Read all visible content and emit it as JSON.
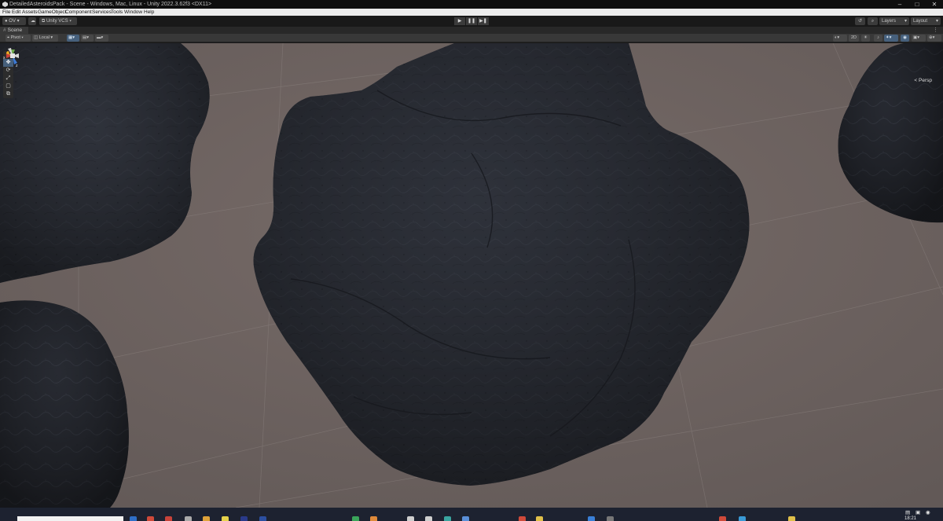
{
  "window": {
    "title": "DetailedAsteroidsPack - Scene - Windows, Mac, Linux - Unity 2022.3.62f3 <DX11>",
    "controls": [
      "–",
      "□",
      "✕"
    ]
  },
  "menu": [
    "File",
    "Edit",
    "Assets",
    "GameObject",
    "Component",
    "Services",
    "Tools",
    "Window",
    "Help"
  ],
  "toolbar": {
    "account": "OV",
    "vcs": "Unity VCS",
    "play_icon": "▶",
    "pause_icon": "❚❚",
    "step_icon": "▶❚",
    "history_icon": "↺",
    "search_icon": "⌕",
    "layers": "Layers",
    "layout": "Layout"
  },
  "scene_tab": {
    "label": "Scene",
    "icon": "#",
    "menu": "⋮"
  },
  "scene_toolbar": {
    "pivot": "Pivot",
    "local": "Local",
    "mode_2d": "2D",
    "persp_label": "< Persp"
  },
  "tools": [
    {
      "name": "hand-tool-icon",
      "glyph": "✋"
    },
    {
      "name": "move-tool-icon",
      "glyph": "✥"
    },
    {
      "name": "rotate-tool-icon",
      "glyph": "⟳"
    },
    {
      "name": "scale-tool-icon",
      "glyph": "⤢"
    },
    {
      "name": "rect-tool-icon",
      "glyph": "▢"
    },
    {
      "name": "transform-tool-icon",
      "glyph": "⧉"
    }
  ],
  "colors": {
    "viewport_bg": "#6c6260",
    "asteroid": "#2a2d34",
    "accent_blue": "#46607c",
    "menu_bg": "#ececec"
  },
  "taskbar": {
    "clock": "18:21"
  }
}
